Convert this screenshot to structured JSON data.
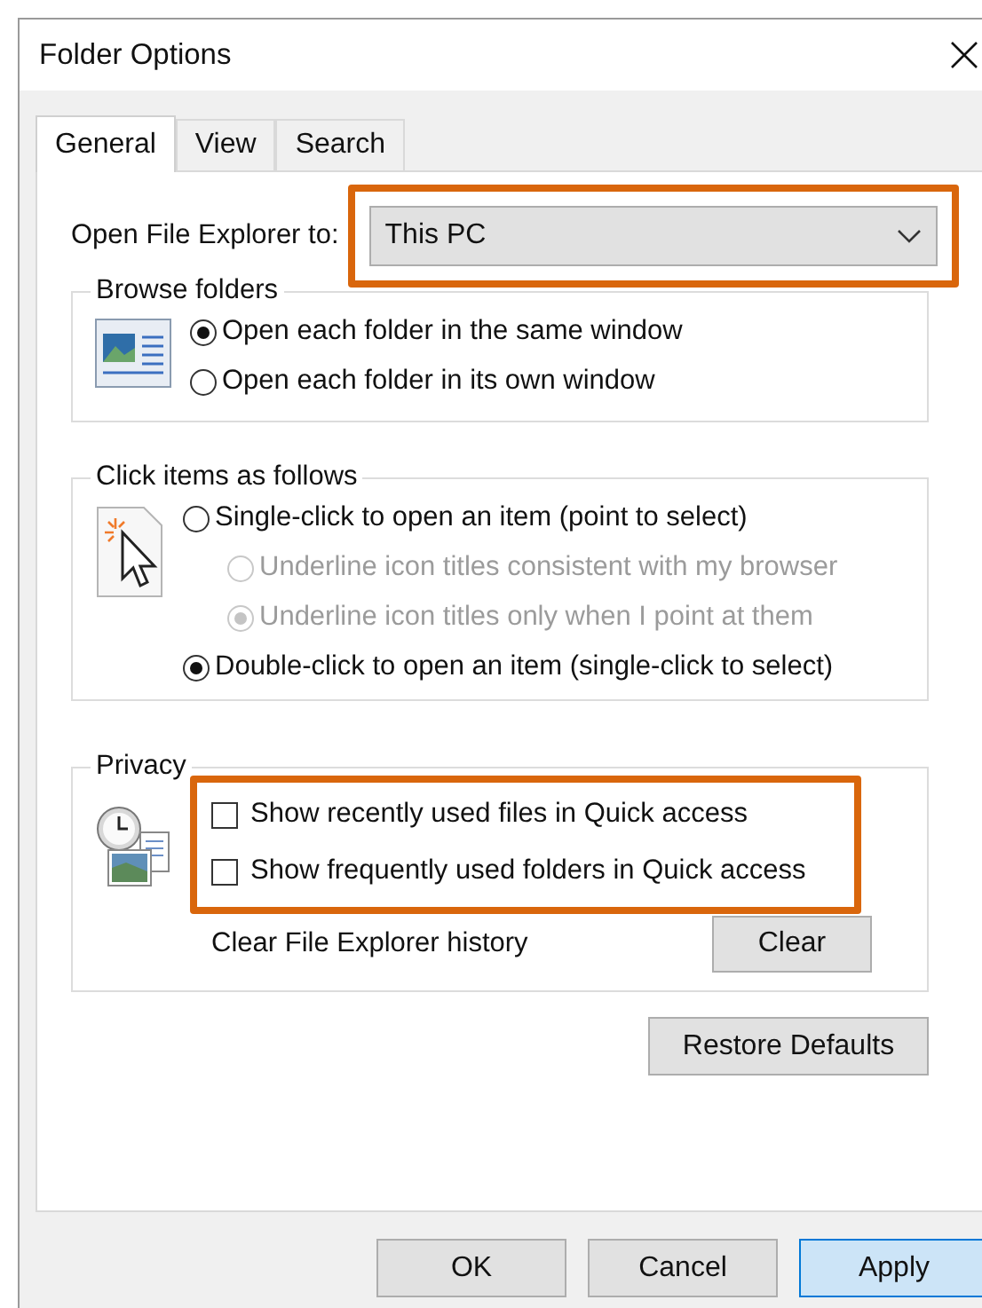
{
  "window": {
    "title": "Folder Options"
  },
  "tabs": [
    {
      "label": "General",
      "selected": true
    },
    {
      "label": "View",
      "selected": false
    },
    {
      "label": "Search",
      "selected": false
    }
  ],
  "open_to": {
    "label": "Open File Explorer to:",
    "value": "This PC",
    "highlighted": true
  },
  "browse_folders": {
    "title": "Browse folders",
    "options": [
      {
        "label": "Open each folder in the same window",
        "selected": true,
        "disabled": false
      },
      {
        "label": "Open each folder in its own window",
        "selected": false,
        "disabled": false
      }
    ]
  },
  "click_items": {
    "title": "Click items as follows",
    "options": [
      {
        "label": "Single-click to open an item (point to select)",
        "selected": false,
        "disabled": false,
        "children": [
          {
            "label": "Underline icon titles consistent with my browser",
            "selected": false,
            "disabled": true
          },
          {
            "label": "Underline icon titles only when I point at them",
            "selected": true,
            "disabled": true
          }
        ]
      },
      {
        "label": "Double-click to open an item (single-click to select)",
        "selected": true,
        "disabled": false
      }
    ]
  },
  "privacy": {
    "title": "Privacy",
    "highlighted": true,
    "checkboxes": [
      {
        "label": "Show recently used files in Quick access",
        "checked": false
      },
      {
        "label": "Show frequently used folders in Quick access",
        "checked": false
      }
    ],
    "history_label": "Clear File Explorer history",
    "clear_button": "Clear"
  },
  "restore_button": "Restore Defaults",
  "buttons": [
    {
      "label": "OK",
      "focused": false
    },
    {
      "label": "Cancel",
      "focused": false
    },
    {
      "label": "Apply",
      "focused": true
    }
  ]
}
